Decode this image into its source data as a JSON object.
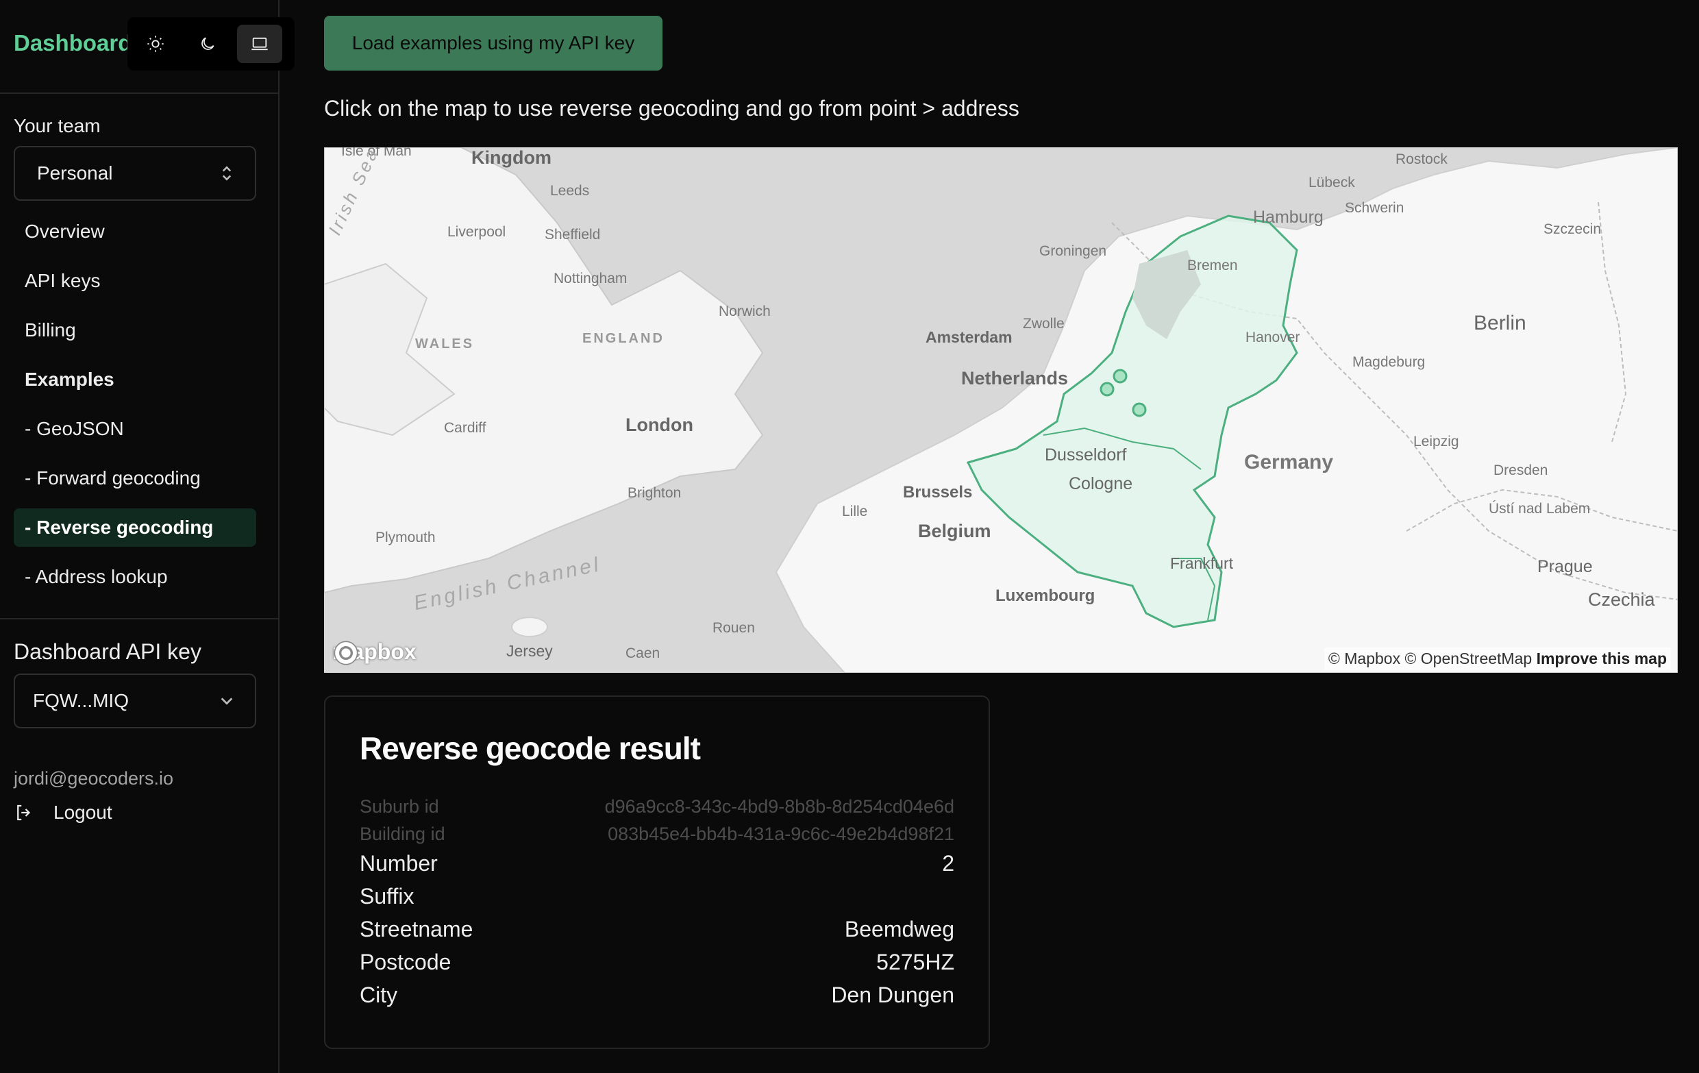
{
  "sidebar": {
    "brand": "Dashboard",
    "theme_buttons": [
      "sun-icon",
      "moon-icon",
      "laptop-icon"
    ],
    "team_label": "Your team",
    "team_value": "Personal",
    "nav": [
      {
        "label": "Overview"
      },
      {
        "label": "API keys"
      },
      {
        "label": "Billing"
      },
      {
        "label": "Examples"
      },
      {
        "label": "- GeoJSON"
      },
      {
        "label": "- Forward geocoding"
      },
      {
        "label": "- Reverse geocoding"
      },
      {
        "label": "- Address lookup"
      }
    ],
    "api_key_label": "Dashboard API key",
    "api_key_value": "FQW...MIQ",
    "email": "jordi@geocoders.io",
    "logout": "Logout"
  },
  "main": {
    "load_button": "Load examples using my API key",
    "instructions": "Click on the map to use reverse geocoding and go from point > address",
    "map": {
      "labels": {
        "isle_of_man": "Isle of Man",
        "kingdom": "Kingdom",
        "leeds": "Leeds",
        "irish_sea": "Irish Sea",
        "liverpool": "Liverpool",
        "sheffield": "Sheffield",
        "nottingham": "Nottingham",
        "wales": "WALES",
        "england": "ENGLAND",
        "norwich": "Norwich",
        "cardiff": "Cardiff",
        "london": "London",
        "brighton": "Brighton",
        "plymouth": "Plymouth",
        "english_channel": "English Channel",
        "jersey": "Jersey",
        "caen": "Caen",
        "rouen": "Rouen",
        "lille": "Lille",
        "brussels": "Brussels",
        "belgium": "Belgium",
        "luxembourg": "Luxembourg",
        "amsterdam": "Amsterdam",
        "netherlands": "Netherlands",
        "groningen": "Groningen",
        "zwolle": "Zwolle",
        "dusseldorf": "Dusseldorf",
        "cologne": "Cologne",
        "frankfurt": "Frankfurt",
        "bremen": "Bremen",
        "hamburg": "Hamburg",
        "lubeck": "Lübeck",
        "schwerin": "Schwerin",
        "rostock": "Rostock",
        "szczecin": "Szczecin",
        "hanover": "Hanover",
        "magdeburg": "Magdeburg",
        "berlin": "Berlin",
        "germany": "Germany",
        "leipzig": "Leipzig",
        "dresden": "Dresden",
        "usti": "Ústí nad Labem",
        "prague": "Prague",
        "czechia": "Czechia"
      },
      "logo": "mapbox",
      "attribution": "© Mapbox © OpenStreetMap",
      "improve": "Improve this map",
      "highlight_color": "#4caf7f"
    }
  },
  "result": {
    "title": "Reverse geocode result",
    "rows": [
      {
        "key": "Suburb id",
        "value": "d96a9cc8-343c-4bd9-8b8b-8d254cd04e6d"
      },
      {
        "key": "Building id",
        "value": "083b45e4-bb4b-431a-9c6c-49e2b4d98f21"
      },
      {
        "key": "Number",
        "value": "2"
      },
      {
        "key": "Suffix",
        "value": ""
      },
      {
        "key": "Streetname",
        "value": "Beemdweg"
      },
      {
        "key": "Postcode",
        "value": "5275HZ"
      },
      {
        "key": "City",
        "value": "Den Dungen"
      }
    ]
  }
}
